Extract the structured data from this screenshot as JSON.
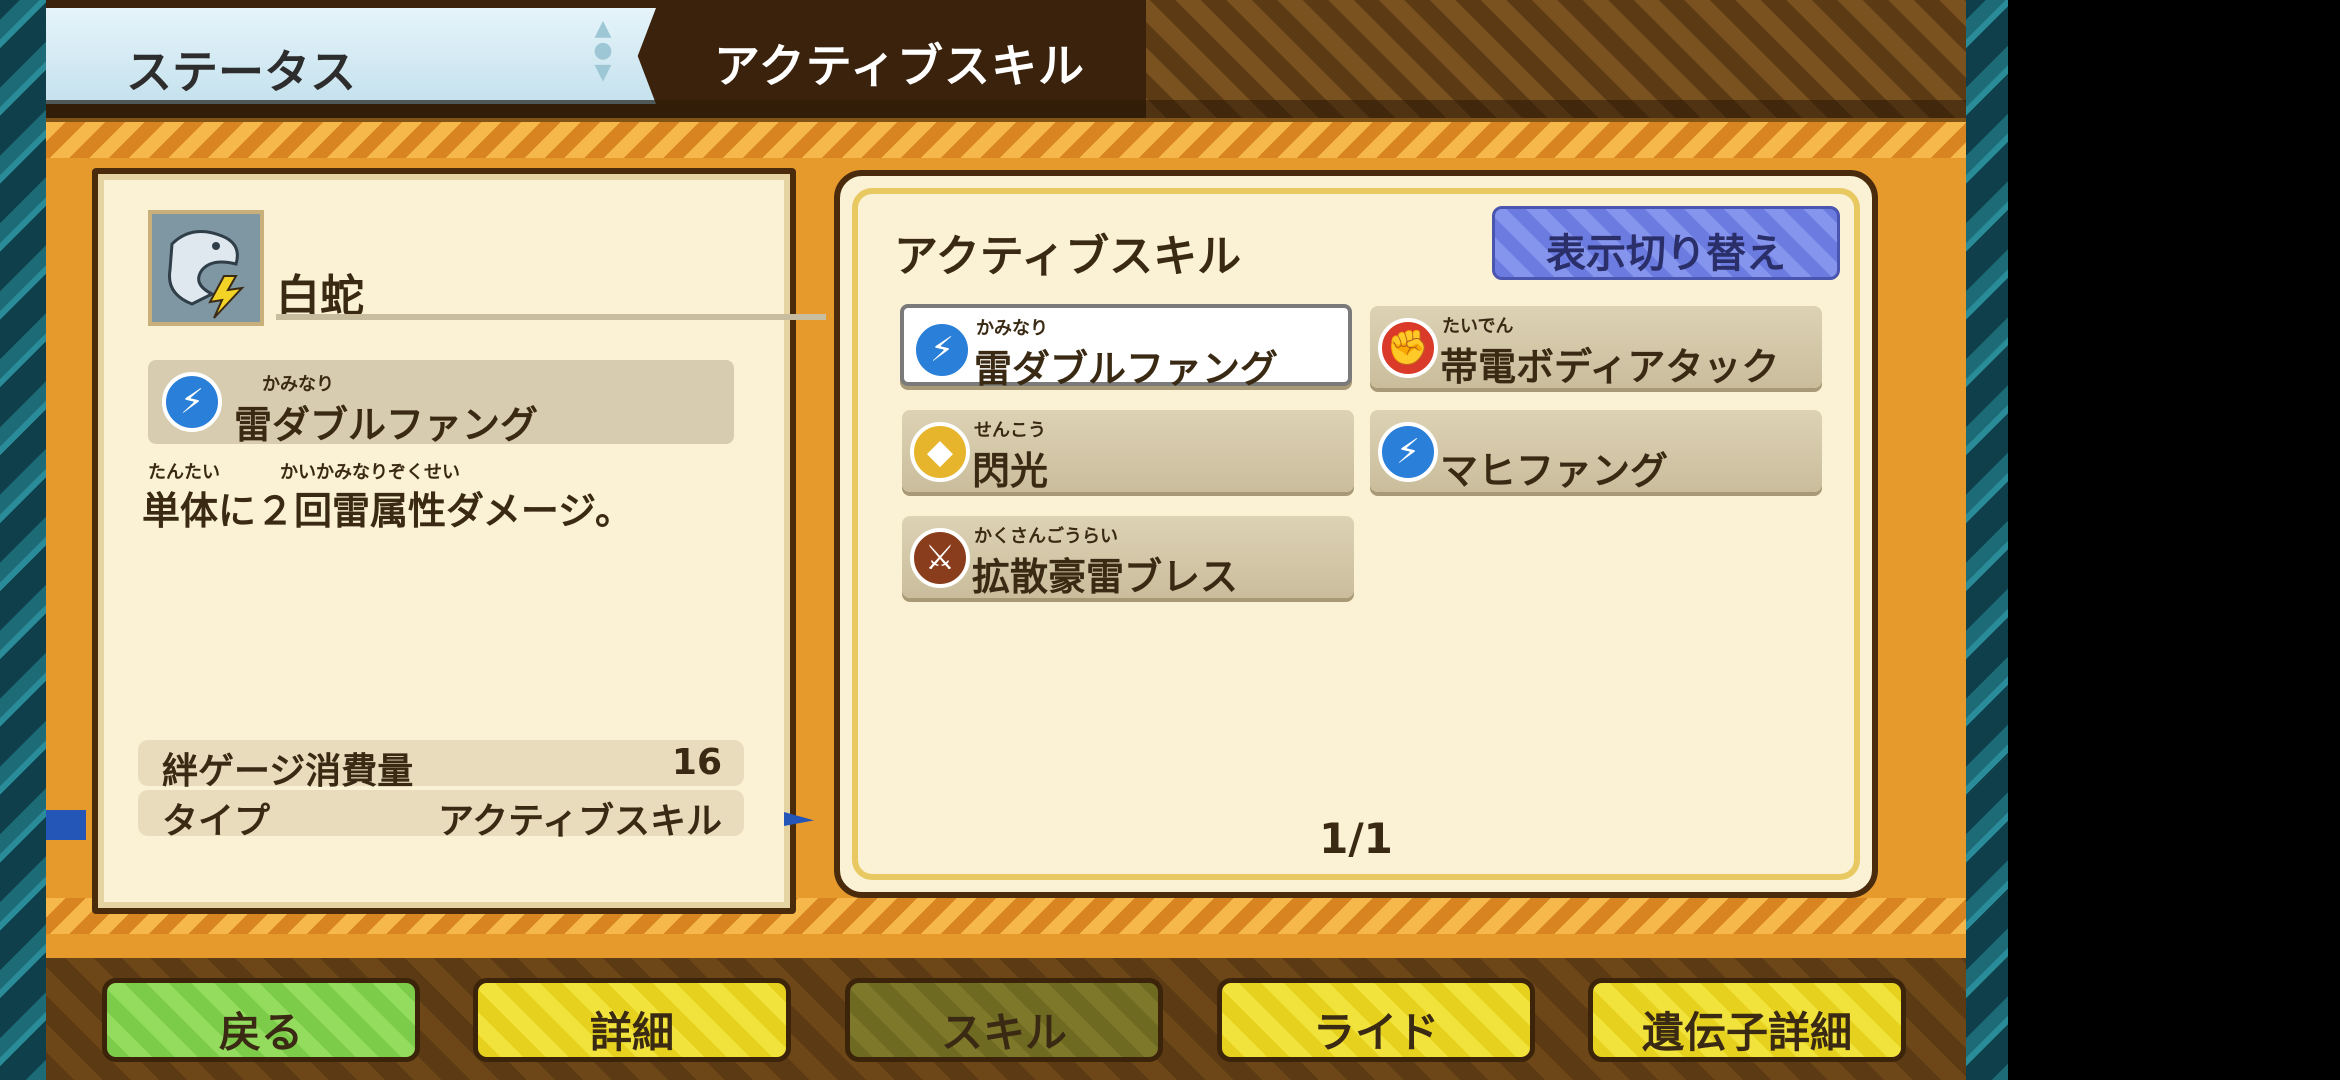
{
  "header": {
    "status_tab_label": "ステータス",
    "title": "アクティブスキル"
  },
  "monster": {
    "name": "白蛇",
    "portrait_icon": "white-serpent-portrait-icon"
  },
  "selected_skill": {
    "ruby": "かみなり",
    "name": "雷ダブルファング",
    "icon": "blue-skill-icon",
    "description_ruby_1": "たんたい",
    "description_ruby_2": "かいかみなりぞくせい",
    "description": "単体に２回雷属性ダメージ。"
  },
  "stats": [
    {
      "label": "絆ゲージ消費量",
      "value": "16"
    },
    {
      "label": "タイプ",
      "value": "アクティブスキル"
    }
  ],
  "skills_panel": {
    "title": "アクティブスキル",
    "toggle_button": "表示切り替え",
    "page_indicator": "1/1",
    "skills": [
      {
        "ruby": "かみなり",
        "name": "雷ダブルファング",
        "icon": "blue",
        "selected": true
      },
      {
        "ruby": "たいでん",
        "name": "帯電ボディアタック",
        "icon": "red",
        "selected": false
      },
      {
        "ruby": "せんこう",
        "name": "閃光",
        "icon": "yellow",
        "selected": false
      },
      {
        "ruby": "",
        "name": "マヒファング",
        "icon": "blue",
        "selected": false
      },
      {
        "ruby": "かくさんごうらい",
        "name": "拡散豪雷ブレス",
        "icon": "brown",
        "selected": false
      }
    ]
  },
  "nav": {
    "back": "戻る",
    "detail": "詳細",
    "skill": "スキル",
    "ride": "ライド",
    "gene_detail": "遺伝子詳細"
  },
  "colors": {
    "background_orange": "#e69a2c",
    "panel_cream": "#fbf1d4",
    "nav_green": "#7ccc4a",
    "nav_yellow": "#e6d21e",
    "toggle_blue": "#6b7be0"
  }
}
